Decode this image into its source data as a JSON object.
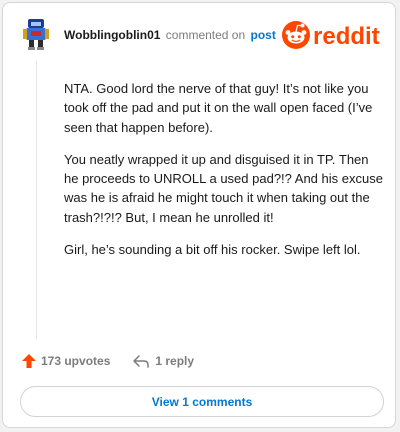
{
  "comment": {
    "username": "Wobblingoblin01",
    "action_text": "commented on",
    "post_link": "post",
    "paragraphs": [
      "NTA. Good lord the nerve of that guy! It’s not like you took off the pad and put it on the wall open faced (I’ve seen that happen before).",
      "You neatly wrapped it up and disguised it in TP. Then he proceeds to UNROLL a used pad?!? And his excuse was he is afraid he might touch it when taking out the trash?!?!? But, I mean he unrolled it!",
      "Girl, he’s sounding a bit off his rocker. Swipe left lol."
    ],
    "upvotes": "173 upvotes",
    "replies": "1 reply",
    "view_comments": "View 1 comments"
  },
  "brand": {
    "name": "reddit",
    "accent": "#ff4500",
    "link_color": "#0079d3"
  },
  "icons": {
    "avatar": "robot-avatar-icon",
    "logo": "reddit-logo-icon",
    "upvote": "upvote-arrow-icon",
    "reply": "reply-arrow-icon"
  }
}
